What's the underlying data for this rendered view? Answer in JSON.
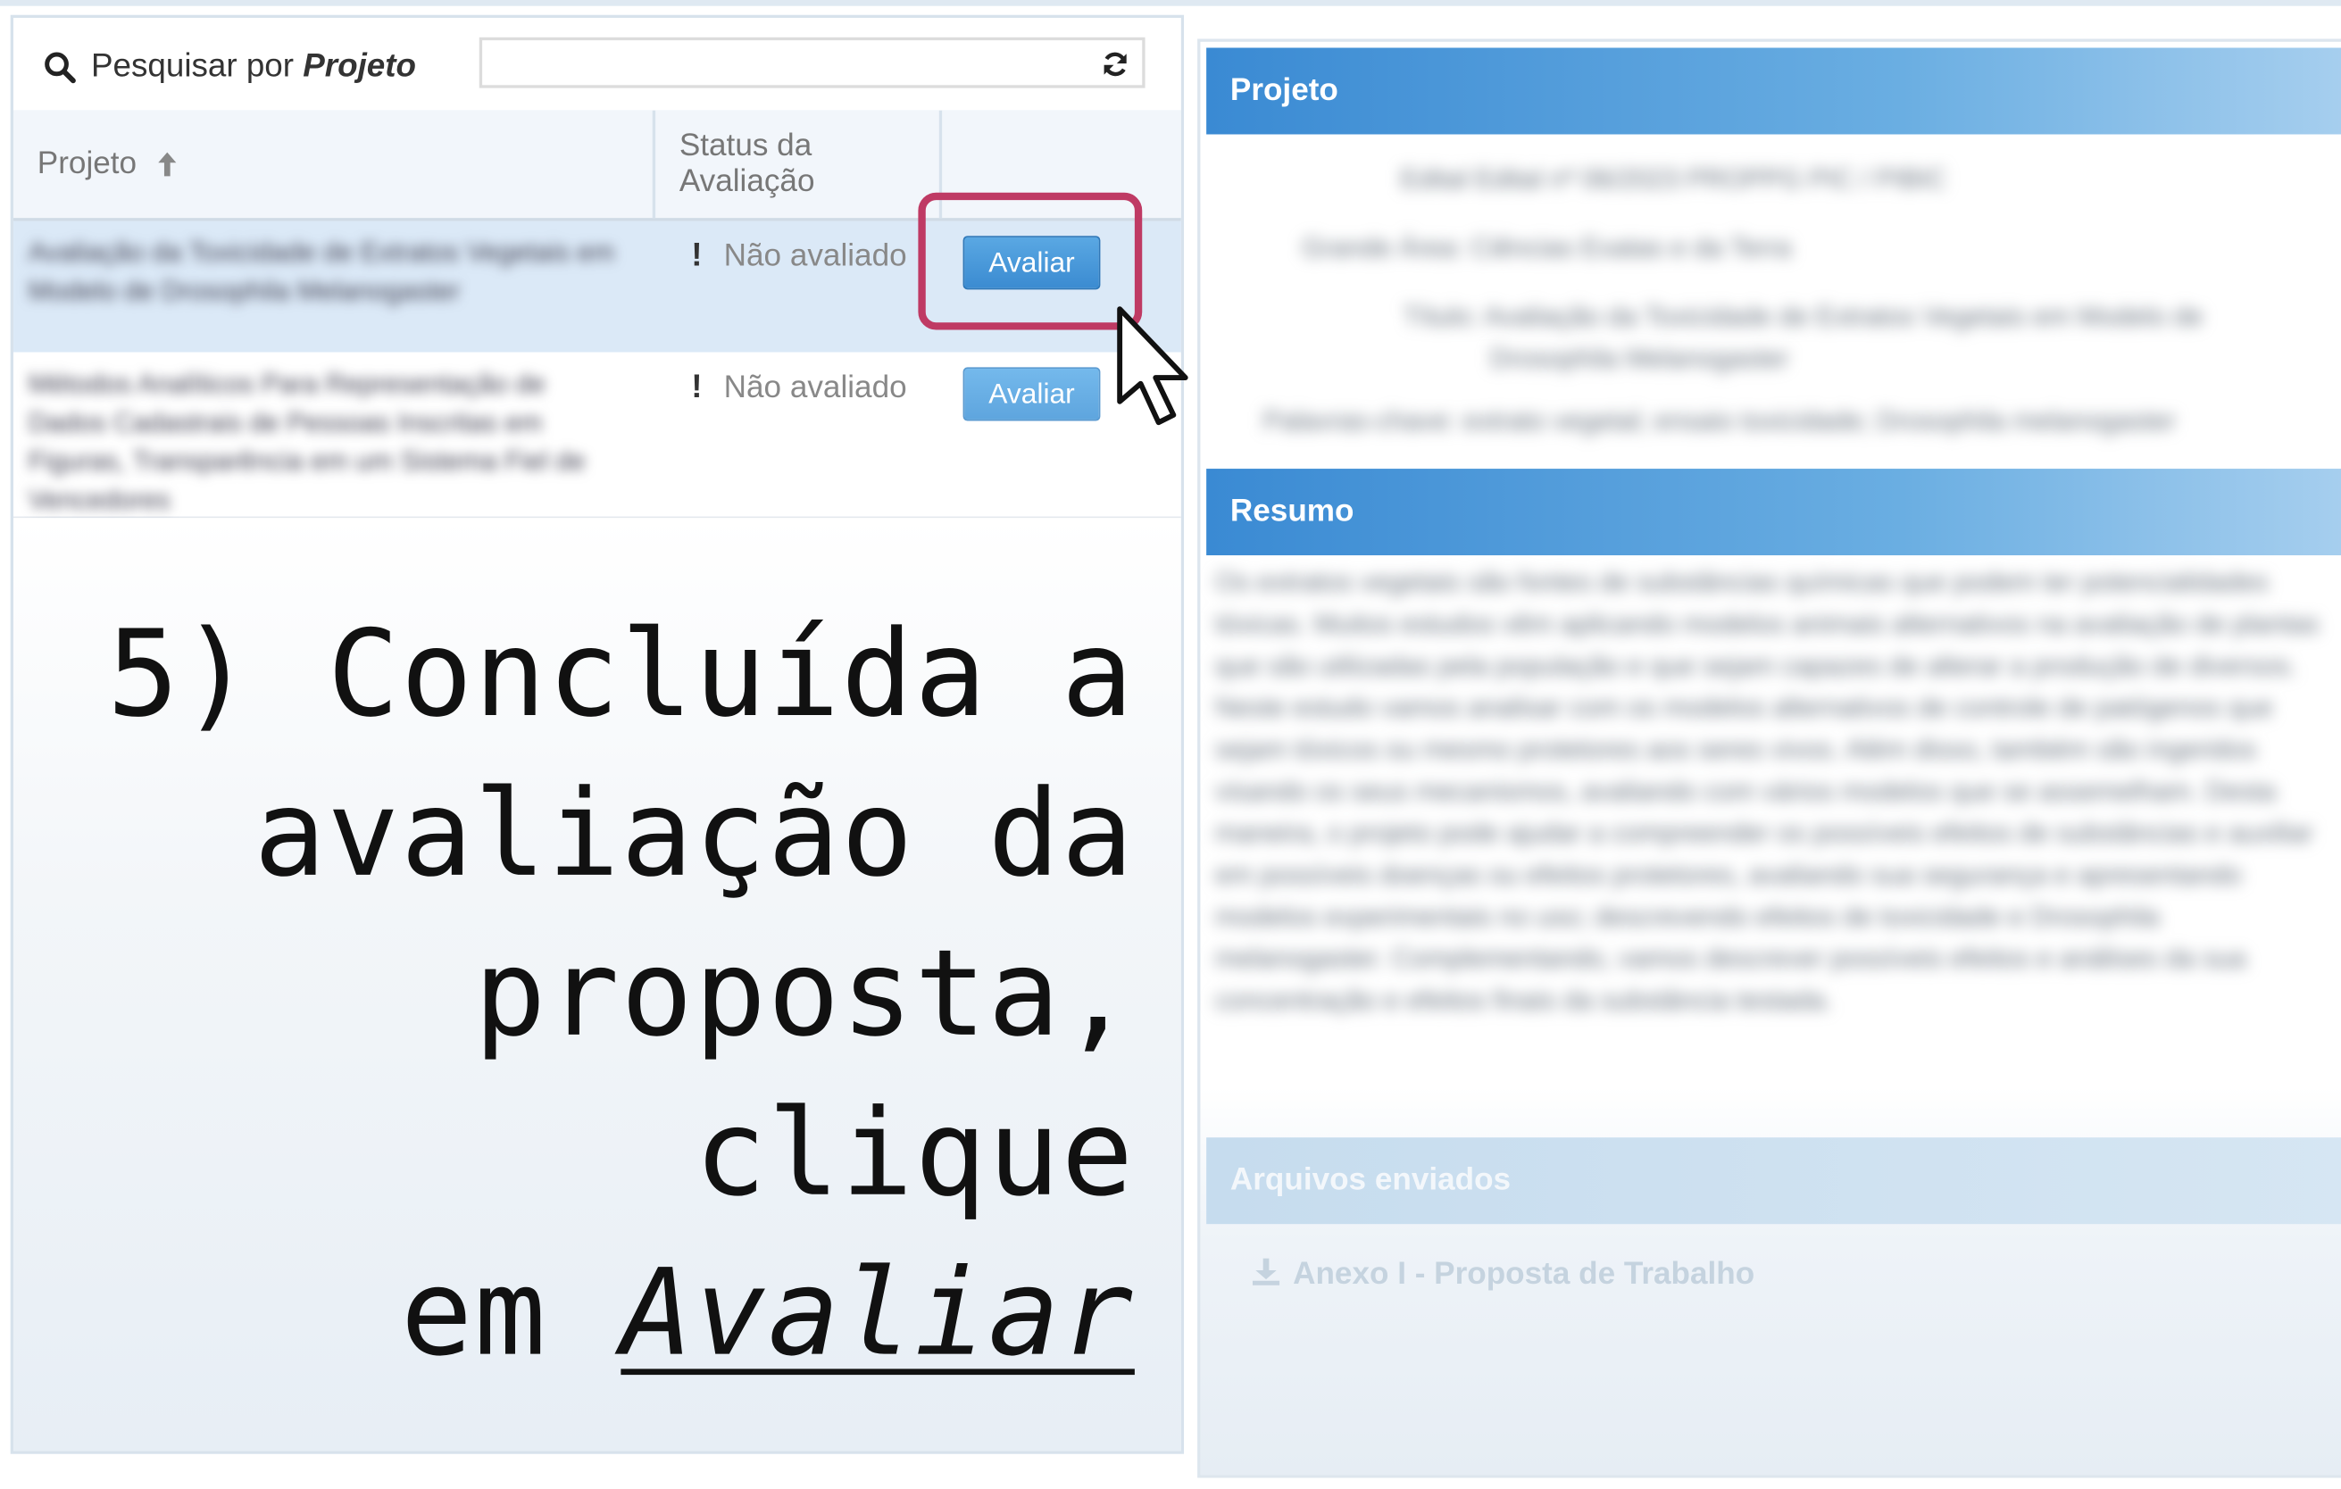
{
  "search": {
    "prefix": "Pesquisar por",
    "field": "Projeto",
    "value": ""
  },
  "table": {
    "columns": [
      "Projeto",
      "Status da Avaliação"
    ],
    "rows": [
      {
        "project": "Avaliação da Toxicidade de Extratos Vegetais em Modelo de Drosophila Melanogaster",
        "status_mark": "!",
        "status": "Não avaliado",
        "action": "Avaliar"
      },
      {
        "project": "Métodos Analíticos Para Representação de Dados Cadastrais de Pessoas Inscritas em Figuras, Transparência em um Sistema Fiel de Vencedores",
        "status_mark": "!",
        "status": "Não avaliado",
        "action": "Avaliar"
      }
    ]
  },
  "instruction": {
    "line1": "5) Concluída a",
    "line2": "avaliação da",
    "line3": "proposta, clique",
    "line4_prefix": "em ",
    "keyword": "Avaliar"
  },
  "detail": {
    "project_header": "Projeto",
    "project_lines": [
      "Edital Edital nº 06/2023 PROPPG PIC / PIBIC",
      "Grande Área: Ciências Exatas e da Terra",
      "Título: Avaliação da Toxicidade de Extratos Vegetais em Modelo de",
      "Drosophila Melanogaster",
      "Palavras-chave: extrato vegetal; ensaio toxicidade; Drosophila melanogaster"
    ],
    "summary_header": "Resumo",
    "summary_text": "Os extratos vegetais são fontes de substâncias químicas que podem ter potencialidades tóxicas. Muitos estudos vêm aplicando modelos animais alternativos na avaliação de plantas que são utilizadas pela população e que sejam capazes de alterar a produção de diversos. Neste estudo vamos analisar com os modelos alternativos de controle de patógenos que sejam tóxicos ou mesmo protetores aos seres vivos. Além disso, também são ingeridos visando os seus mecanismos, avaliando com vários modelos que se assemelham. Desta maneira, o projeto pode ajudar a compreender os possíveis efeitos de substâncias e auxiliar em possíveis doenças ou efeitos protetores, avaliando sua segurança e apresentando modelos experimentais no uso; descrevendo efeitos de toxicidade e Drosophila melanogaster. Complementando, vamos descrever possíveis efeitos e análises da sua concentração e efeitos finais da substância testada.",
    "files_header": "Arquivos enviados",
    "file_name": "Anexo I - Proposta de Trabalho"
  },
  "colors": {
    "header_blue": "#3a8ad3",
    "button_blue": "#3b8bd1",
    "highlight": "#bf3a64"
  }
}
